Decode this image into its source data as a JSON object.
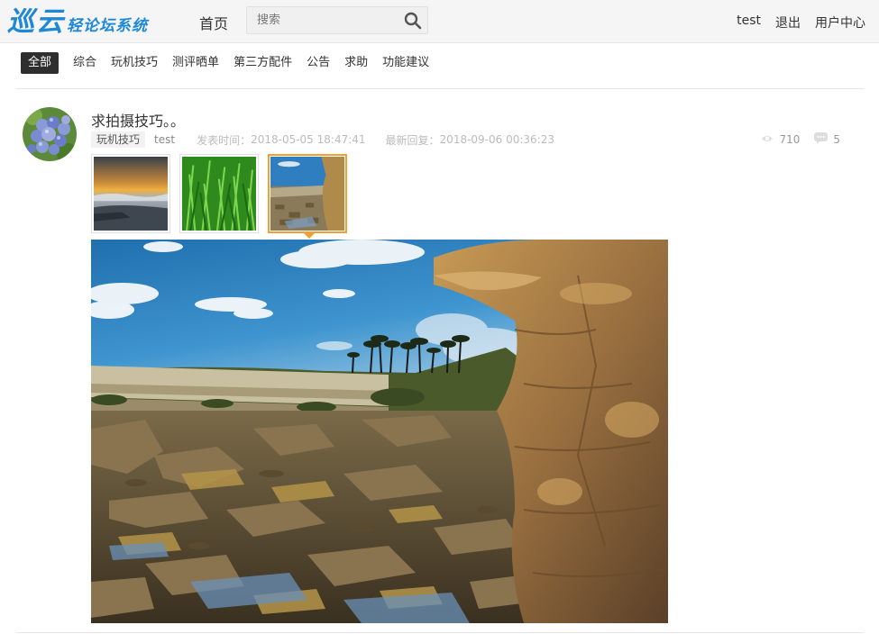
{
  "header": {
    "logo_main": "巡云",
    "logo_sub": "轻论坛系统",
    "home_label": "首页",
    "search_placeholder": "搜索",
    "user_name": "test",
    "logout_label": "退出",
    "user_center_label": "用户中心"
  },
  "categories": [
    "全部",
    "综合",
    "玩机技巧",
    "测评晒单",
    "第三方配件",
    "公告",
    "求助",
    "功能建议"
  ],
  "active_category": "全部",
  "post": {
    "title": "求拍摄技巧。。",
    "tag": "玩机技巧",
    "author": "test",
    "published_label": "发表时间：",
    "published_time": "2018-05-05 18:47:41",
    "reply_label": "最新回复：",
    "reply_time": "2018-09-06 00:36:23",
    "views": "710",
    "comments": "5",
    "thumbnails": [
      "sunset-lake",
      "grass",
      "rocky-coast"
    ],
    "active_thumbnail": 2
  },
  "icons": {
    "search": "search-icon",
    "views": "eye-icon",
    "comments": "comment-icon"
  },
  "colors": {
    "logo": "#1e88d6",
    "active_category_bg": "#2e2e2e",
    "active_thumb_border": "#f0a030"
  }
}
